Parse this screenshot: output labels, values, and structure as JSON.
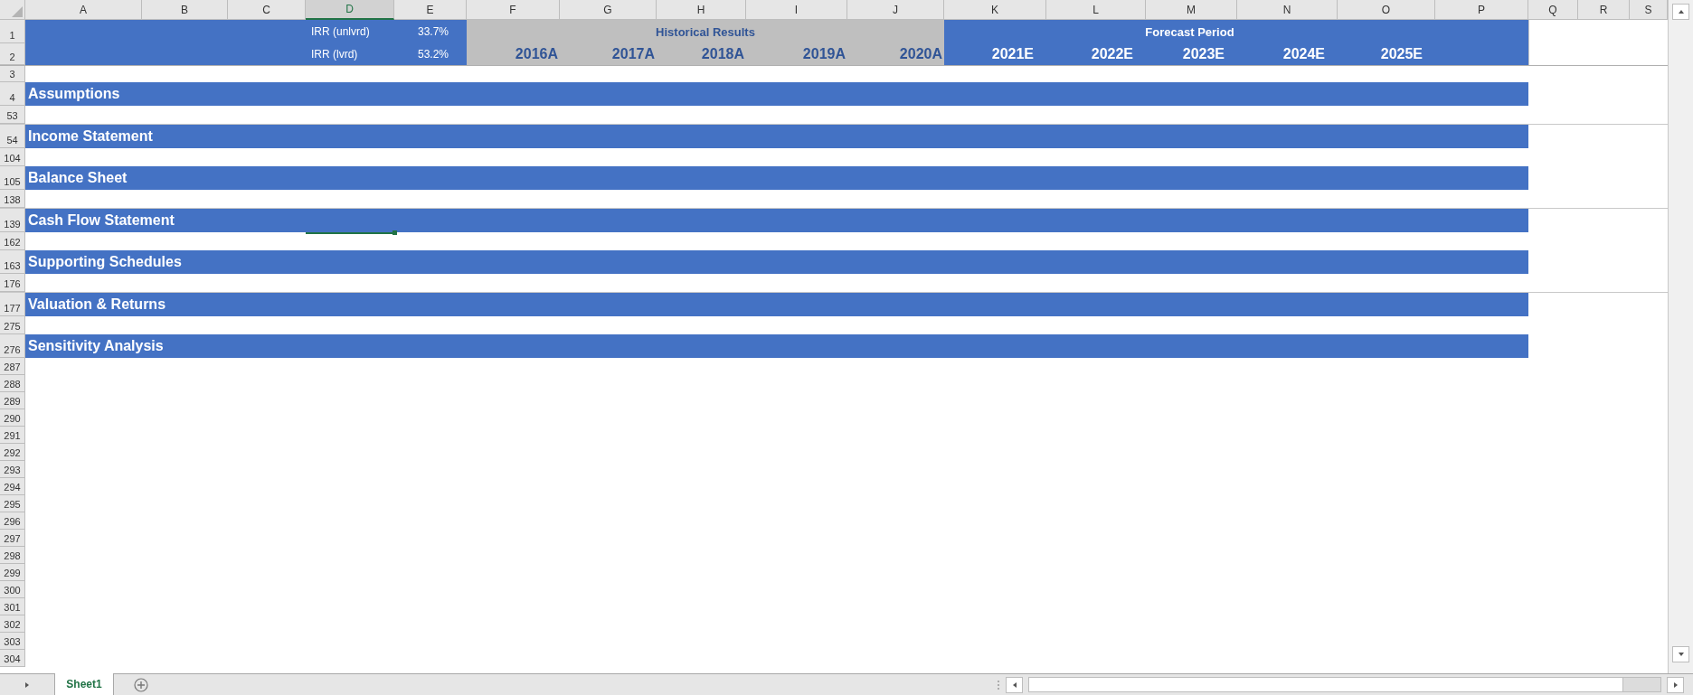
{
  "columns": [
    {
      "label": "A",
      "selected": false
    },
    {
      "label": "B",
      "selected": false
    },
    {
      "label": "C",
      "selected": false
    },
    {
      "label": "D",
      "selected": true
    },
    {
      "label": "E",
      "selected": false
    },
    {
      "label": "F",
      "selected": false
    },
    {
      "label": "G",
      "selected": false
    },
    {
      "label": "H",
      "selected": false
    },
    {
      "label": "I",
      "selected": false
    },
    {
      "label": "J",
      "selected": false
    },
    {
      "label": "K",
      "selected": false
    },
    {
      "label": "L",
      "selected": false
    },
    {
      "label": "M",
      "selected": false
    },
    {
      "label": "N",
      "selected": false
    },
    {
      "label": "O",
      "selected": false
    },
    {
      "label": "P",
      "selected": false
    },
    {
      "label": "Q",
      "selected": false
    },
    {
      "label": "R",
      "selected": false
    },
    {
      "label": "S",
      "selected": false
    }
  ],
  "summary": {
    "rows": [
      {
        "number": "1",
        "metric": "IRR (unlvrd)",
        "value": "33.7%"
      },
      {
        "number": "2",
        "metric": "IRR (lvrd)",
        "value": "53.2%"
      }
    ]
  },
  "historical": {
    "title": "Historical Results",
    "years": [
      "2016A",
      "2017A",
      "2018A",
      "2019A",
      "2020A"
    ]
  },
  "forecast": {
    "title": "Forecast Period",
    "years": [
      "2021E",
      "2022E",
      "2023E",
      "2024E",
      "2025E"
    ]
  },
  "spacer_row": "3",
  "sections": [
    {
      "row": "4",
      "title": "Assumptions",
      "selected": false,
      "spacer_row": "53"
    },
    {
      "row": "54",
      "title": "Income Statement",
      "selected": false,
      "spacer_row": "104"
    },
    {
      "row": "105",
      "title": "Balance Sheet",
      "selected": false,
      "spacer_row": "138"
    },
    {
      "row": "139",
      "title": "Cash Flow Statement",
      "selected": true,
      "spacer_row": "162"
    },
    {
      "row": "163",
      "title": "Supporting Schedules",
      "selected": false,
      "spacer_row": "176"
    },
    {
      "row": "177",
      "title": "Valuation & Returns",
      "selected": false,
      "spacer_row": "275"
    },
    {
      "row": "276",
      "title": "Sensitivity Analysis",
      "selected": false
    }
  ],
  "blank_rows": [
    "287",
    "288",
    "289",
    "290",
    "291",
    "292",
    "293",
    "294",
    "295",
    "296",
    "297",
    "298",
    "299",
    "300",
    "301",
    "302",
    "303",
    "304"
  ],
  "sheet_tabs": [
    {
      "label": "Sheet1",
      "selected": true
    }
  ]
}
